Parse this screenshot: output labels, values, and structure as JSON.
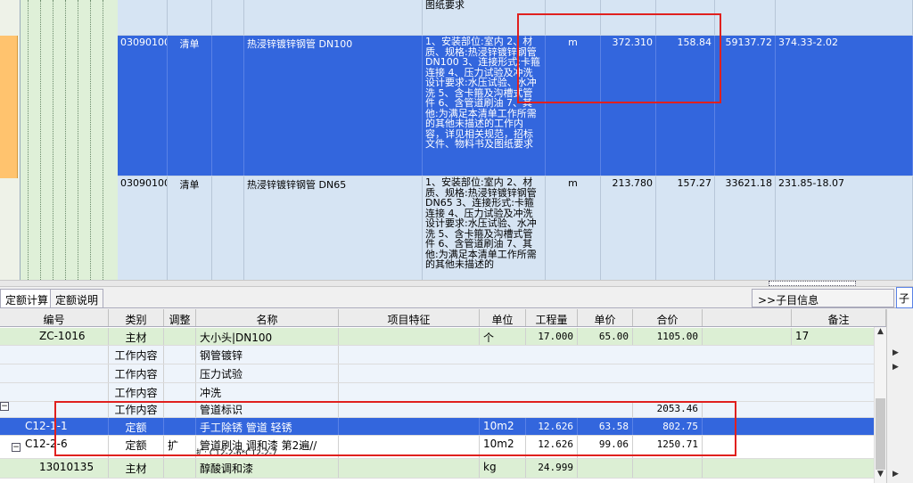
{
  "top_rows": [
    {
      "feature": "工作内容，详见相关规范，招标文件、物料书及图纸要求"
    },
    {
      "code": "03090100",
      "category": "清单",
      "name": "热浸锌镀锌钢管 DN100",
      "feature": "1、安装部位:室内 2、材质、规格:热浸锌镀锌钢管 DN100 3、连接形式:卡箍连接 4、压力试验及冲洗设计要求:水压试验、水冲洗 5、含卡箍及沟槽式管件 6、含管道刷油 7、其他:为满足本清单工作所需的其他未描述的工作内容，详见相关规范，招标文件、物料书及图纸要求",
      "unit": "m",
      "quantity": "372.310",
      "unit_price": "158.84",
      "total": "59137.72",
      "extra": "374.33-2.02"
    },
    {
      "code": "03090100",
      "category": "清单",
      "name": "热浸锌镀锌钢管 DN65",
      "feature": "1、安装部位:室内 2、材质、规格:热浸锌镀锌钢管 DN65 3、连接形式:卡箍连接 4、压力试验及冲洗设计要求:水压试验、水冲洗 5、含卡箍及沟槽式管件 6、含管道刷油 7、其他:为满足本清单工作所需的其他未描述的",
      "unit": "m",
      "quantity": "213.780",
      "unit_price": "157.27",
      "total": "33621.18",
      "extra": "231.85-18.07"
    }
  ],
  "tabs": {
    "calc": "定额计算",
    "desc": "定额说明",
    "sub_info": ">>子目信息",
    "side": "子"
  },
  "bottom_headers": {
    "code": "编号",
    "category": "类别",
    "adjust": "调整",
    "name": "名称",
    "feature": "项目特征",
    "unit": "单位",
    "quantity": "工程量",
    "unit_price": "单价",
    "total": "合价",
    "note": "备注"
  },
  "bottom_rows": [
    {
      "code": "ZC-1016",
      "category": "主材",
      "adjust": "",
      "name": "大小头|DN100",
      "unit": "个",
      "quantity": "17.000",
      "unit_price": "65.00",
      "total": "1105.00",
      "note": "17"
    },
    {
      "code": "",
      "category": "工作内容",
      "adjust": "",
      "name": "钢管镀锌",
      "unit": "",
      "quantity": "",
      "unit_price": "",
      "total": "",
      "note": ""
    },
    {
      "code": "",
      "category": "工作内容",
      "adjust": "",
      "name": "压力试验",
      "unit": "",
      "quantity": "",
      "unit_price": "",
      "total": "",
      "note": ""
    },
    {
      "code": "",
      "category": "工作内容",
      "adjust": "",
      "name": "冲洗",
      "unit": "",
      "quantity": "",
      "unit_price": "",
      "total": "",
      "note": ""
    },
    {
      "code": "",
      "category": "工作内容",
      "adjust": "",
      "name": "管道标识",
      "unit": "",
      "quantity": "",
      "unit_price": "",
      "total": "2053.46",
      "note": ""
    },
    {
      "code": "C12-1-1",
      "category": "定额",
      "adjust": "",
      "name": "手工除锈 管道 轻锈",
      "unit": "10m2",
      "quantity": "12.626",
      "unit_price": "63.58",
      "total": "802.75",
      "note": ""
    },
    {
      "code": "C12-2-6",
      "category": "定额",
      "adjust": "扩",
      "name": "管道刷油 调和漆 第2遍//",
      "name_note": "扩: C12-2-6*C12-2-7",
      "unit": "10m2",
      "quantity": "12.626",
      "unit_price": "99.06",
      "total": "1250.71",
      "note": ""
    },
    {
      "code": "13010135",
      "category": "主材",
      "adjust": "",
      "name": "醇酸调和漆",
      "unit": "kg",
      "quantity": "24.999",
      "unit_price": "",
      "total": "",
      "note": ""
    }
  ]
}
